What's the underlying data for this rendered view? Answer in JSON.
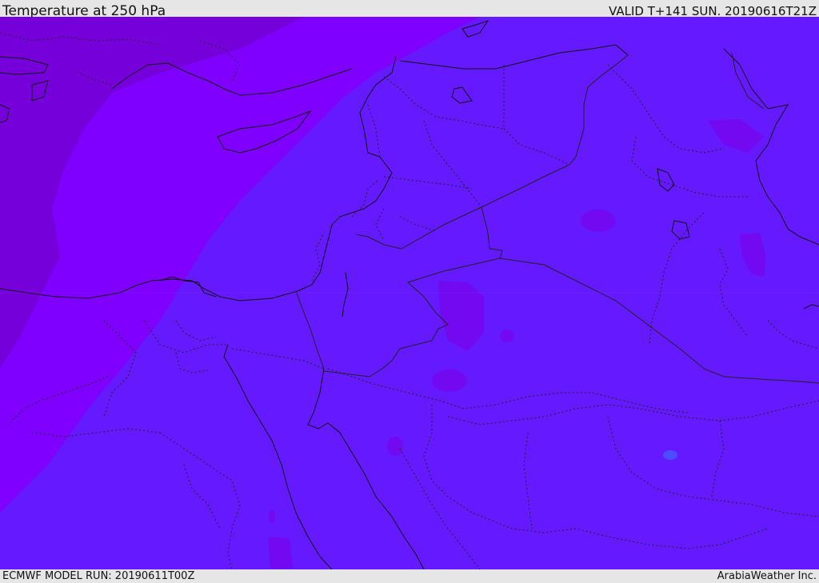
{
  "header": {
    "title": "Temperature at 250 hPa",
    "valid_time": "VALID T+141 SUN. 20190616T21Z"
  },
  "footer": {
    "model_run": "ECMWF MODEL RUN: 20190611T00Z",
    "credit": "ArabiaWeather Inc."
  },
  "colors": {
    "field_base": "#6419ff",
    "field_mid": "#7f00ff",
    "field_dark": "#7500d9",
    "field_cold_patch": "#7309f0",
    "field_warm_patch": "#4b4bff",
    "coastline": "#111111",
    "borders": "#222222"
  }
}
